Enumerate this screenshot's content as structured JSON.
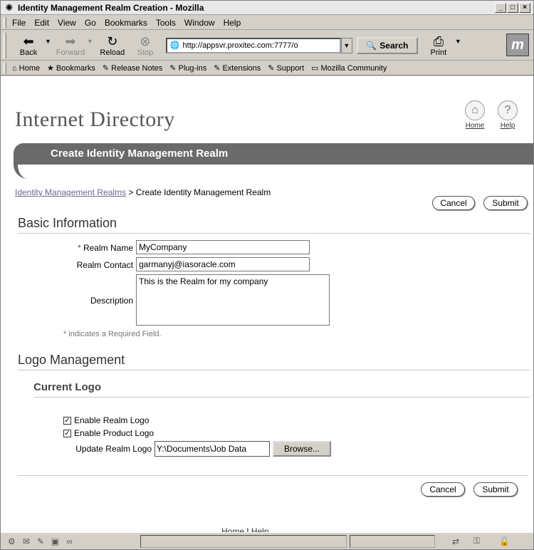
{
  "window": {
    "title": "Identity Management Realm Creation - Mozilla",
    "app_icon": "mozilla-icon",
    "buttons": [
      "_",
      "□",
      "×"
    ]
  },
  "menubar": {
    "items": [
      {
        "label": "File",
        "accel": "F"
      },
      {
        "label": "Edit",
        "accel": "E"
      },
      {
        "label": "View",
        "accel": "V"
      },
      {
        "label": "Go",
        "accel": "G"
      },
      {
        "label": "Bookmarks",
        "accel": "B"
      },
      {
        "label": "Tools",
        "accel": "T"
      },
      {
        "label": "Window",
        "accel": "W"
      },
      {
        "label": "Help",
        "accel": "H"
      }
    ]
  },
  "navbar": {
    "back": "Back",
    "forward": "Forward",
    "reload": "Reload",
    "stop": "Stop",
    "url": "http://appsvr.proxitec.com:7777/o",
    "search": "Search",
    "print": "Print"
  },
  "personal_toolbar": {
    "items": [
      "Home",
      "Bookmarks",
      "Release Notes",
      "Plug-ins",
      "Extensions",
      "Support",
      "Mozilla Community"
    ]
  },
  "page": {
    "brand": "Internet Directory",
    "global_home": "Home",
    "global_help": "Help",
    "title": "Create Identity Management Realm",
    "breadcrumb_link": "Identity Management Realms",
    "breadcrumb_sep": ">",
    "breadcrumb_current": "Create Identity Management Realm",
    "cancel": "Cancel",
    "submit": "Submit",
    "basic_info": {
      "heading": "Basic Information",
      "realm_name_label": "Realm Name",
      "required_marker": "*",
      "realm_name_value": "MyCompany",
      "realm_contact_label": "Realm Contact",
      "realm_contact_value": "garmanyj@iasoracle.com",
      "description_label": "Description",
      "description_value": "This is the Realm for my company",
      "required_hint": "indicates a Required Field."
    },
    "logo": {
      "heading": "Logo Management",
      "subheading": "Current Logo",
      "enable_realm_logo": "Enable Realm Logo",
      "enable_product_logo": "Enable Product Logo",
      "update_label": "Update Realm Logo",
      "file_value": "Y:\\Documents\\Job Data",
      "browse": "Browse..."
    },
    "footer_home": "Home",
    "footer_sep": "|",
    "footer_help": "Help"
  }
}
